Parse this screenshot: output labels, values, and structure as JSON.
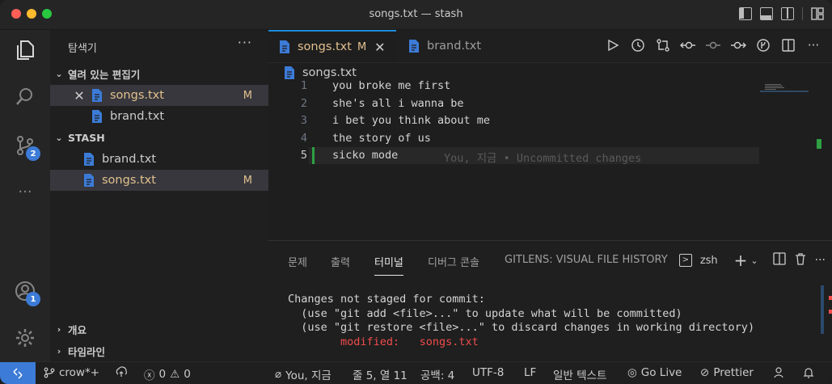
{
  "window": {
    "title": "songs.txt — stash"
  },
  "activity": {
    "scm_badge": "2",
    "accounts_badge": "1",
    "more": "···"
  },
  "sidebar": {
    "title": "탐색기",
    "more": "···",
    "open_editors": {
      "label": "열려 있는 편집기",
      "files": [
        {
          "name": "songs.txt",
          "status": "M"
        },
        {
          "name": "brand.txt",
          "status": ""
        }
      ]
    },
    "workspace": {
      "label": "STASH",
      "files": [
        {
          "name": "brand.txt",
          "status": ""
        },
        {
          "name": "songs.txt",
          "status": "M"
        }
      ]
    },
    "outline": "개요",
    "timeline": "타임라인"
  },
  "tabs": [
    {
      "label": "songs.txt",
      "status": "M",
      "active": true
    },
    {
      "label": "brand.txt",
      "status": "",
      "active": false
    }
  ],
  "breadcrumb": "songs.txt",
  "editor": {
    "lines": [
      {
        "n": "1",
        "text": "you broke me first"
      },
      {
        "n": "2",
        "text": "she's all i wanna be"
      },
      {
        "n": "3",
        "text": "i bet you think about me"
      },
      {
        "n": "4",
        "text": "the story of us"
      },
      {
        "n": "5",
        "text": "sicko mode"
      }
    ],
    "blame": "You, 지금 • Uncommitted changes"
  },
  "panel": {
    "tabs": [
      "문제",
      "출력",
      "터미널",
      "디버그 콘솔",
      "GITLENS: VISUAL FILE HISTORY"
    ],
    "active_tab": "터미널",
    "shell": "zsh",
    "terminal": [
      "Changes not staged for commit:",
      "  (use \"git add <file>...\" to update what will be committed)",
      "  (use \"git restore <file>...\" to discard changes in working directory)"
    ],
    "modified_label": "modified:",
    "modified_file": "songs.txt"
  },
  "status": {
    "branch": "crow*+",
    "errors": "0",
    "warnings": "0",
    "blame": "You, 지금",
    "position": "줄 5, 열 11",
    "indent": "공백: 4",
    "encoding": "UTF-8",
    "eol": "LF",
    "language": "일반 텍스트",
    "golive": "Go Live",
    "prettier": "Prettier"
  },
  "colors": {
    "accent": "#3c7bd7",
    "modified": "#e2c08d",
    "added": "#2ea043",
    "terminal_red": "#f14c4c",
    "active_tab_border": "#1e8bd8"
  }
}
